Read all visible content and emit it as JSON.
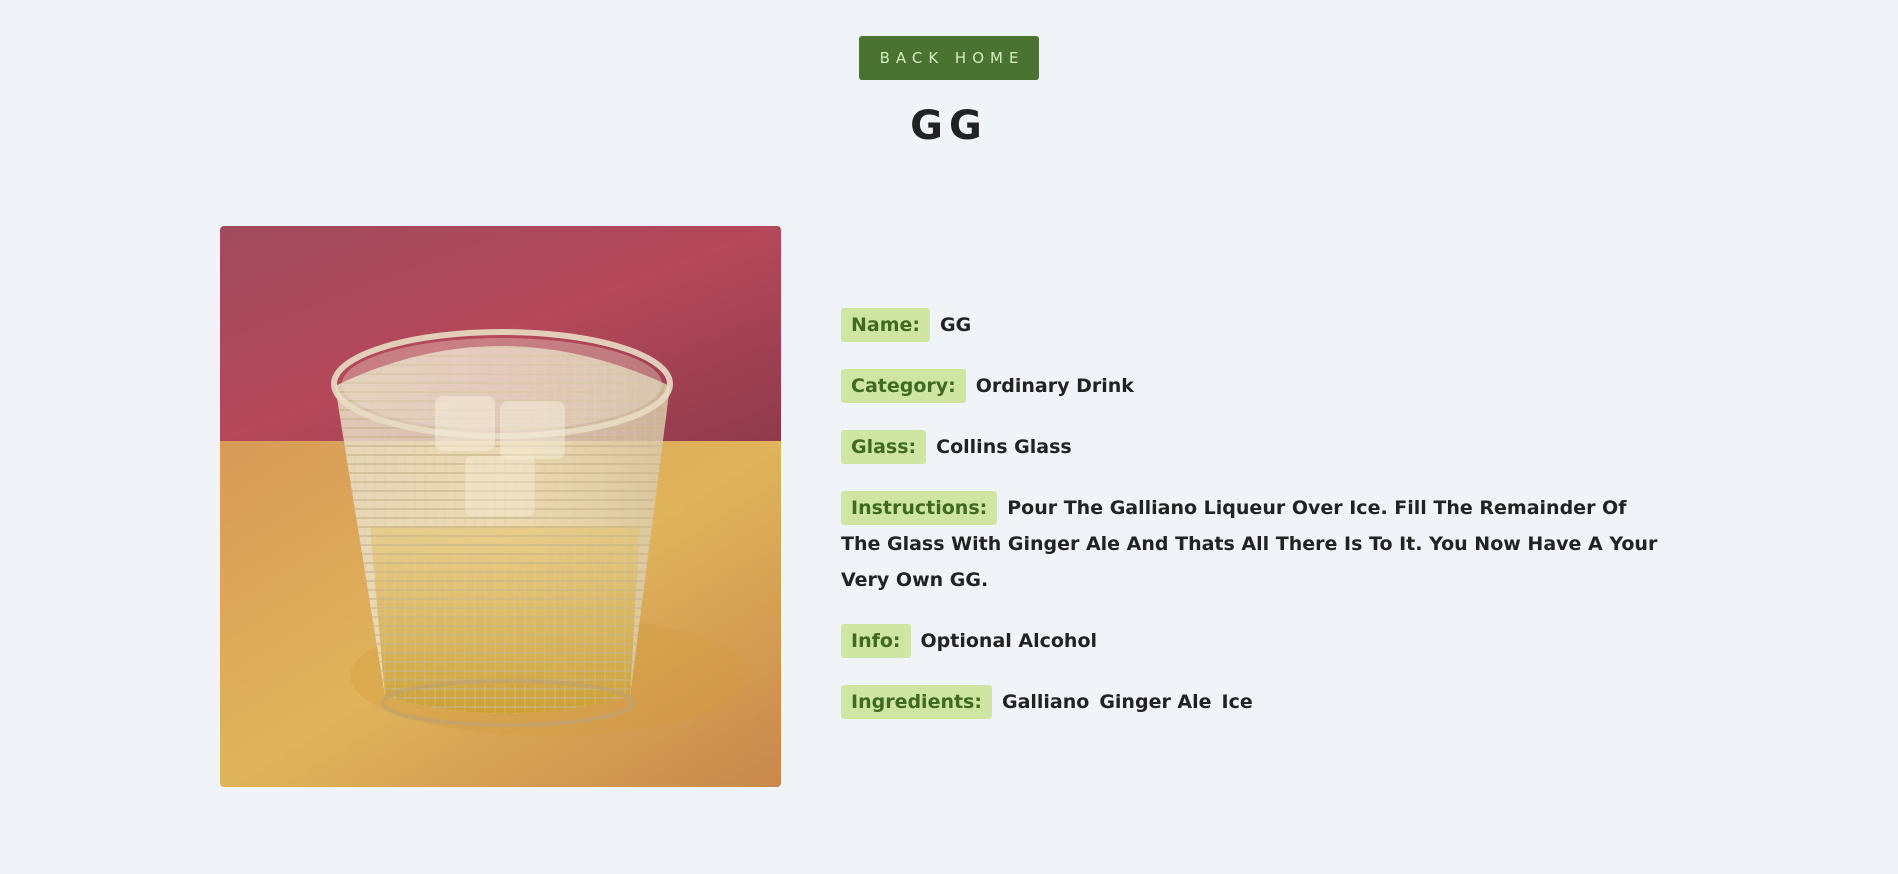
{
  "header": {
    "back_button_label": "Back Home",
    "title": "GG"
  },
  "photo": {
    "alt": "GG"
  },
  "details": {
    "name_label": "Name:",
    "name_value": "GG",
    "category_label": "Category:",
    "category_value": "Ordinary Drink",
    "glass_label": "Glass:",
    "glass_value": "Collins Glass",
    "instructions_label": "Instructions:",
    "instructions_value": "Pour The Galliano Liqueur Over Ice. Fill The Remainder Of The Glass With Ginger Ale And Thats All There Is To It. You Now Have A Your Very Own GG.",
    "info_label": "Info:",
    "info_value": "Optional Alcohol",
    "ingredients_label": "Ingredients:",
    "ingredients": [
      "Galliano",
      "Ginger Ale",
      "Ice"
    ]
  },
  "colors": {
    "background": "#f0f4f8",
    "button": "#4a7332",
    "button_text": "#d6ebbf",
    "label_bg": "#cfe6a3",
    "label_text": "#3f6a23"
  }
}
